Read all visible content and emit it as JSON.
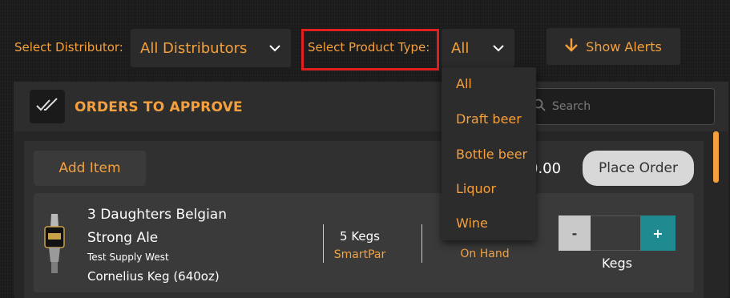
{
  "filters": {
    "distributor_label": "Select Distributor:",
    "distributor_value": "All Distributors",
    "product_type_label": "Select Product Type:",
    "product_type_value": "All",
    "alerts_label": "Show Alerts"
  },
  "product_type_dropdown": {
    "options": [
      "All",
      "Draft beer",
      "Bottle beer",
      "Liquor",
      "Wine"
    ]
  },
  "panel": {
    "title": "ORDERS TO APPROVE",
    "search_placeholder": "Search",
    "add_item_label": "Add Item",
    "total_visible": "0.00",
    "place_order_label": "Place Order"
  },
  "item": {
    "name_line1": "3 Daughters Belgian",
    "name_line2": "Strong Ale",
    "supplier": "Test Supply West",
    "container": "Cornelius Keg (640oz)",
    "par_value": "5 Kegs",
    "par_label": "SmartPar",
    "on_hand_label": "On Hand",
    "stepper_minus": "-",
    "stepper_plus": "+",
    "unit": "Kegs"
  },
  "colors": {
    "accent": "#f5a03c",
    "highlight": "#e02020",
    "plus_button": "#1f8a8f"
  },
  "icons": {
    "chevron": "chevron-down-icon",
    "alerts": "arrow-down-icon",
    "approve": "double-check-icon",
    "search": "search-icon",
    "product": "beer-tap-handle-icon"
  }
}
